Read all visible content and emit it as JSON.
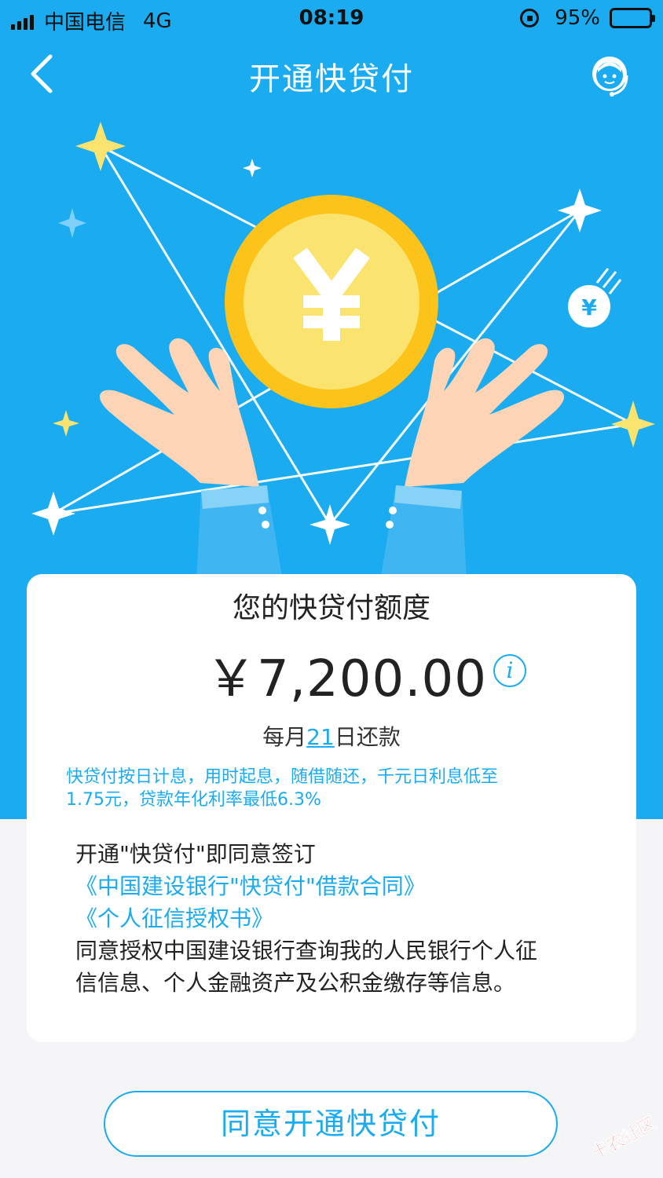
{
  "status_bar": {
    "carrier": "中国电信",
    "network": "4G",
    "time": "08:19",
    "battery": "95%"
  },
  "nav": {
    "title": "开通快贷付",
    "back_icon": "chevron-left-icon",
    "service_icon": "customer-service-icon"
  },
  "card": {
    "title": "您的快贷付额度",
    "amount": "￥7,200.00",
    "repay_prefix": "每月",
    "repay_day": "21",
    "repay_suffix": "日还款",
    "notice_line1": "快贷付按日计息，用时起息，随借随还，千元日利息低至",
    "notice_line2": "1.75元，贷款年化利率最低6.3%",
    "agreement_intro": "开通\"快贷付\"即同意签订",
    "contract_link": "《中国建设银行\"快贷付\"借款合同》",
    "credit_link": "《个人征信授权书》",
    "authorization_line1": "同意授权中国建设银行查询我的人民银行个人征",
    "authorization_line2": "信信息、个人金融资产及公积金缴存等信息。"
  },
  "primary_button": "同意开通快贷付",
  "watermark": "卡农社区",
  "colors": {
    "brand_blue": "#1aabf0",
    "coin_gold": "#fcc31a",
    "coin_inner": "#fbe36f",
    "sleeve": "#3fb6f2"
  }
}
